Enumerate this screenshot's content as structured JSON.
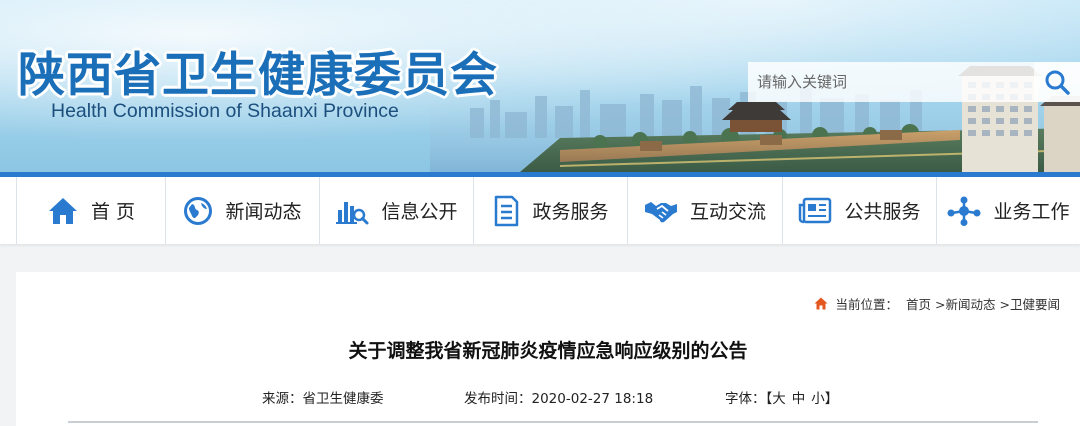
{
  "header": {
    "title_cn": "陕西省卫生健康委员会",
    "title_en": "Health Commission of Shaanxi Province",
    "search": {
      "placeholder": "请输入关键词",
      "value": ""
    },
    "search_icon": "search-icon"
  },
  "nav": {
    "items": [
      {
        "label": "首 页",
        "icon": "home-icon"
      },
      {
        "label": "新闻动态",
        "icon": "globe-icon"
      },
      {
        "label": "信息公开",
        "icon": "chart-search-icon"
      },
      {
        "label": "政务服务",
        "icon": "document-icon"
      },
      {
        "label": "互动交流",
        "icon": "handshake-icon"
      },
      {
        "label": "公共服务",
        "icon": "news-icon"
      },
      {
        "label": "业务工作",
        "icon": "network-icon"
      }
    ],
    "accent_color": "#2a7bd0"
  },
  "breadcrumb": {
    "prefix": "当前位置：",
    "items": [
      "首页",
      ">新闻动态",
      ">卫健要闻"
    ],
    "icon": "home-icon",
    "icon_color": "#e4571f"
  },
  "article": {
    "title": "关于调整我省新冠肺炎疫情应急响应级别的公告",
    "source_label": "来源：",
    "source": "省卫生健康委",
    "time_label": "发布时间：",
    "time": "2020-02-27 18:18",
    "font_label": "字体：",
    "font_open": "【",
    "font_large": "大",
    "font_medium": "中",
    "font_small": "小",
    "font_close": "】"
  }
}
